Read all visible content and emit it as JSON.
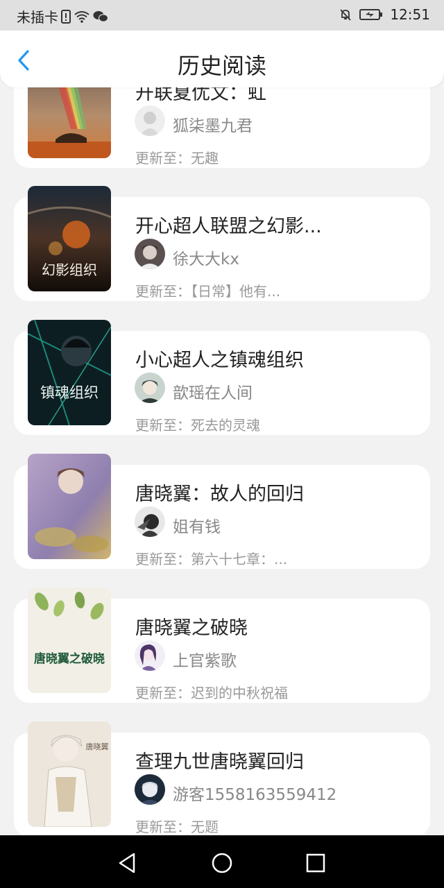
{
  "status_bar": {
    "carrier": "未插卡",
    "time": "12:51",
    "icons": [
      "sim-alert-icon",
      "wifi-icon",
      "wechat-icon",
      "mute-icon",
      "battery-icon"
    ]
  },
  "header": {
    "title": "历史阅读",
    "back_icon": "chevron-left-icon",
    "accent_color": "#2196F3"
  },
  "books": [
    {
      "title": "开联夏优文：虹",
      "author": "狐柒墨九君",
      "update_label": "更新至：",
      "update": "无趣"
    },
    {
      "title": "开心超人联盟之幻影...",
      "author": "徐大大kx",
      "update_label": "更新至：",
      "update": "【日常】他有..."
    },
    {
      "title": "小心超人之镇魂组织",
      "author": "歆瑶在人间",
      "update_label": "更新至：",
      "update": "死去的灵魂"
    },
    {
      "title": "唐晓翼：故人的回归",
      "author": "姐有钱",
      "update_label": "更新至：",
      "update": "第六十七章：..."
    },
    {
      "title": "唐晓翼之破晓",
      "author": "上官紫歌",
      "update_label": "更新至：",
      "update": "迟到的中秋祝福"
    },
    {
      "title": "查理九世唐晓翼回归",
      "author": "游客1558163559412",
      "update_label": "更新至：",
      "update": "无题"
    }
  ],
  "covers": [
    {
      "text": ""
    },
    {
      "text": "幻影组织"
    },
    {
      "text": "镇魂组织"
    },
    {
      "text": ""
    },
    {
      "text": "唐晓翼之破晓"
    },
    {
      "text": "唐晓翼"
    }
  ],
  "nav_bar": {
    "icons": [
      "back-triangle-icon",
      "home-circle-icon",
      "recents-square-icon"
    ]
  }
}
